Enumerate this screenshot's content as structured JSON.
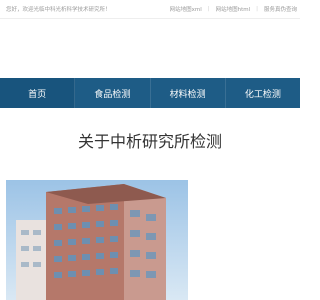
{
  "topbar": {
    "welcome": "您好，欢迎光临中科光析科学技术研究所！",
    "links": [
      "网站地图xml",
      "网站地图html",
      "服务真伪查询"
    ]
  },
  "nav": {
    "items": [
      "首页",
      "食品检测",
      "材料检测",
      "化工检测"
    ]
  },
  "section": {
    "title": "关于中析研究所检测"
  }
}
